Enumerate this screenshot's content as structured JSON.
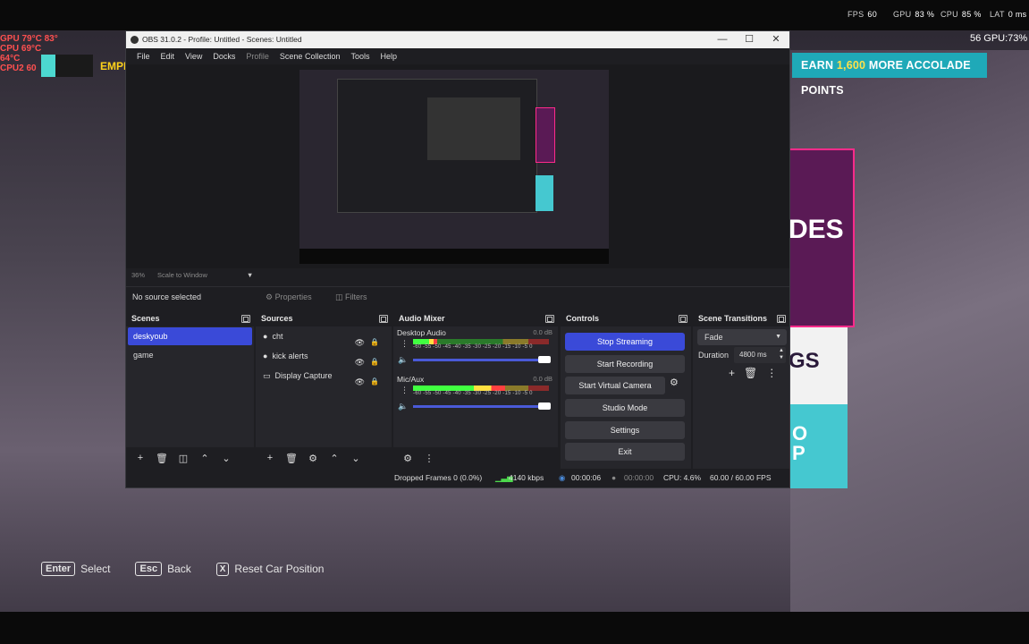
{
  "hud": {
    "fps_label": "FPS",
    "fps_value": "60",
    "gpu_label": "GPU",
    "gpu_value": "83 %",
    "cpu_label": "CPU",
    "cpu_value": "85 %",
    "lat_label": "LAT",
    "lat_value": "0 ms",
    "gpu_right": "56 GPU:73%"
  },
  "left_overlay": {
    "lines": [
      "GPU  79°C  83°",
      "CPU  69°C",
      "      64°C",
      "CPU2  60"
    ],
    "banner": "EMPR"
  },
  "game": {
    "accolade_prefix": "EARN ",
    "accolade_points": "1,600",
    "accolade_suffix": " MORE ACCOLADE POINTS",
    "card_pink": "DES",
    "card_white": "GS",
    "card_teal": "O\nP"
  },
  "hints": [
    {
      "key": "Enter",
      "label": "Select"
    },
    {
      "key": "Esc",
      "label": "Back"
    },
    {
      "key": "X",
      "label": "Reset Car Position"
    }
  ],
  "obs": {
    "title": "OBS 31.0.2 - Profile: Untitled - Scenes: Untitled",
    "menu": [
      "File",
      "Edit",
      "View",
      "Docks",
      "Profile",
      "Scene Collection",
      "Tools",
      "Help"
    ],
    "zoom": "36%",
    "scale_mode": "Scale to Window",
    "no_source": "No source selected",
    "properties": "Properties",
    "filters": "Filters",
    "scenes": {
      "title": "Scenes",
      "items": [
        "deskyoub",
        "game"
      ]
    },
    "sources": {
      "title": "Sources",
      "items": [
        "cht",
        "kick alerts",
        "Display Capture"
      ]
    },
    "mixer": {
      "title": "Audio Mixer",
      "channels": [
        {
          "name": "Desktop Audio",
          "db": "0.0 dB",
          "level": 0.18
        },
        {
          "name": "Mic/Aux",
          "db": "0.0 dB",
          "level": 0.68
        }
      ],
      "scale": "-60 -55 -50 -45 -40 -35 -30 -25 -20 -15 -10 -5  0"
    },
    "controls": {
      "title": "Controls",
      "stop_streaming": "Stop Streaming",
      "start_recording": "Start Recording",
      "start_virtual_camera": "Start Virtual Camera",
      "studio_mode": "Studio Mode",
      "settings": "Settings",
      "exit": "Exit"
    },
    "transitions": {
      "title": "Scene Transitions",
      "selected": "Fade",
      "duration_label": "Duration",
      "duration_value": "4800 ms"
    },
    "status": {
      "dropped": "Dropped Frames 0 (0.0%)",
      "bitrate": "4140 kbps",
      "stream_time": "00:00:06",
      "rec_time": "00:00:00",
      "cpu": "CPU: 4.6%",
      "fps": "60.00 / 60.00 FPS"
    }
  },
  "colors": {
    "accent": "#3a4ad8",
    "teal": "#1fa9b8",
    "pink": "#ff2a8a",
    "gold": "#ffe14a"
  }
}
